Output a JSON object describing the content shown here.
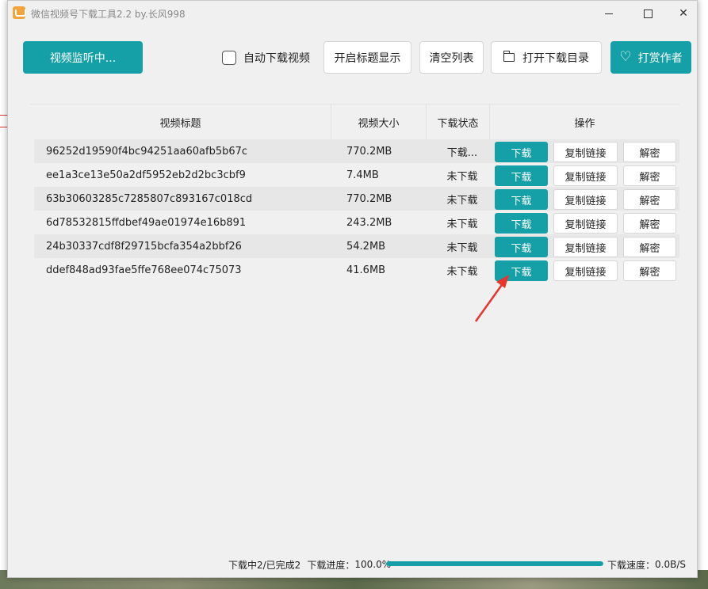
{
  "window": {
    "title": "微信视频号下载工具2.2 by.长风998"
  },
  "toolbar": {
    "monitor_label": "视频监听中...",
    "auto_download_label": "自动下载视频",
    "auto_download_checked": false,
    "title_show_label": "开启标题显示",
    "clear_label": "清空列表",
    "open_dir_label": "打开下载目录",
    "open_dir_icon": "folder-icon",
    "reward_label": "打赏作者",
    "reward_icon": "heart-icon"
  },
  "table": {
    "headers": {
      "title": "视频标题",
      "size": "视频大小",
      "status": "下载状态",
      "ops": "操作"
    },
    "rows": [
      {
        "title": "96252d19590f4bc94251aa60afb5b67c",
        "size": "770.2MB",
        "status": "下载...",
        "download": "下载",
        "copy": "复制链接",
        "decrypt": "解密"
      },
      {
        "title": "ee1a3ce13e50a2df5952eb2d2bc3cbf9",
        "size": "7.4MB",
        "status": "未下载",
        "download": "下载",
        "copy": "复制链接",
        "decrypt": "解密"
      },
      {
        "title": "63b30603285c7285807c893167c018cd",
        "size": "770.2MB",
        "status": "未下载",
        "download": "下载",
        "copy": "复制链接",
        "decrypt": "解密"
      },
      {
        "title": "6d78532815ffdbef49ae01974e16b891",
        "size": "243.2MB",
        "status": "未下载",
        "download": "下载",
        "copy": "复制链接",
        "decrypt": "解密"
      },
      {
        "title": "24b30337cdf8f29715bcfa354a2bbf26",
        "size": "54.2MB",
        "status": "未下载",
        "download": "下载",
        "copy": "复制链接",
        "decrypt": "解密"
      },
      {
        "title": "ddef848ad93fae5ffe768ee074c75073",
        "size": "41.6MB",
        "status": "未下载",
        "download": "下载",
        "copy": "复制链接",
        "decrypt": "解密"
      }
    ]
  },
  "status": {
    "downloading": "下载中2/已完成2",
    "progress_label": "下载进度：",
    "progress_value": "100.0%",
    "progress_fraction": 1.0,
    "speed_label": "下载速度：",
    "speed_value": "0.0B/S"
  },
  "colors": {
    "accent": "#159fa6",
    "annotation_arrow": "#e8352b"
  }
}
